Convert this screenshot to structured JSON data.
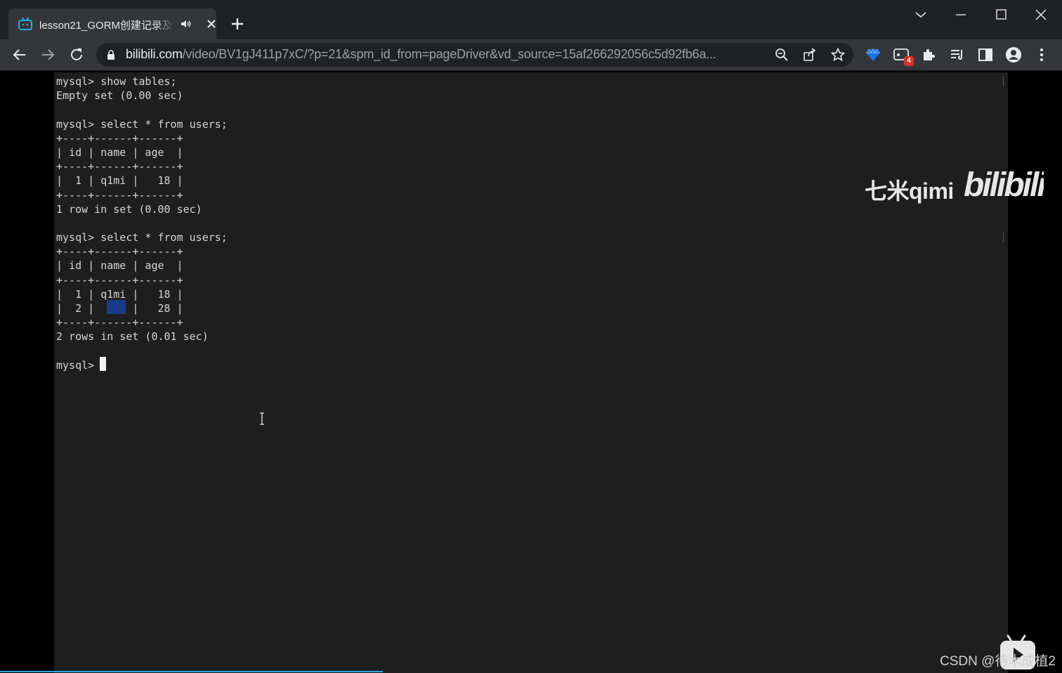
{
  "browser": {
    "tab": {
      "title": "lesson21_GORM创建记录及"
    },
    "address_bar": {
      "host": "bilibili.com",
      "path": "/video/BV1gJ411p7xC/?p=21&spm_id_from=pageDriver&vd_source=15af266292056c5d92fb6a..."
    },
    "extensions_badge": "4"
  },
  "terminal": {
    "lines": [
      "mysql> show tables;",
      "Empty set (0.00 sec)",
      "",
      "mysql> select * from users;",
      "+----+------+------+",
      "| id | name | age  |",
      "+----+------+------+",
      "|  1 | q1mi |   18 |",
      "+----+------+------+",
      "1 row in set (0.00 sec)",
      "",
      "mysql> select * from users;",
      "+----+------+------+",
      "| id | name | age  |",
      "+----+------+------+",
      "|  1 | q1mi |   18 |",
      "|  2 |      |   28 |",
      "+----+------+------+",
      "2 rows in set (0.01 sec)",
      ""
    ],
    "prompt": "mysql> "
  },
  "watermarks": {
    "uploader": "七米qimi",
    "site_logo": "bilibili",
    "csdn": "CSDN @待木成植2"
  },
  "colors": {
    "chrome_dark": "#202124",
    "chrome_toolbar": "#35363a",
    "terminal_bg": "#1e1e1e",
    "bilibili_blue": "#00a1d6",
    "progress": "#2aa6dc"
  }
}
